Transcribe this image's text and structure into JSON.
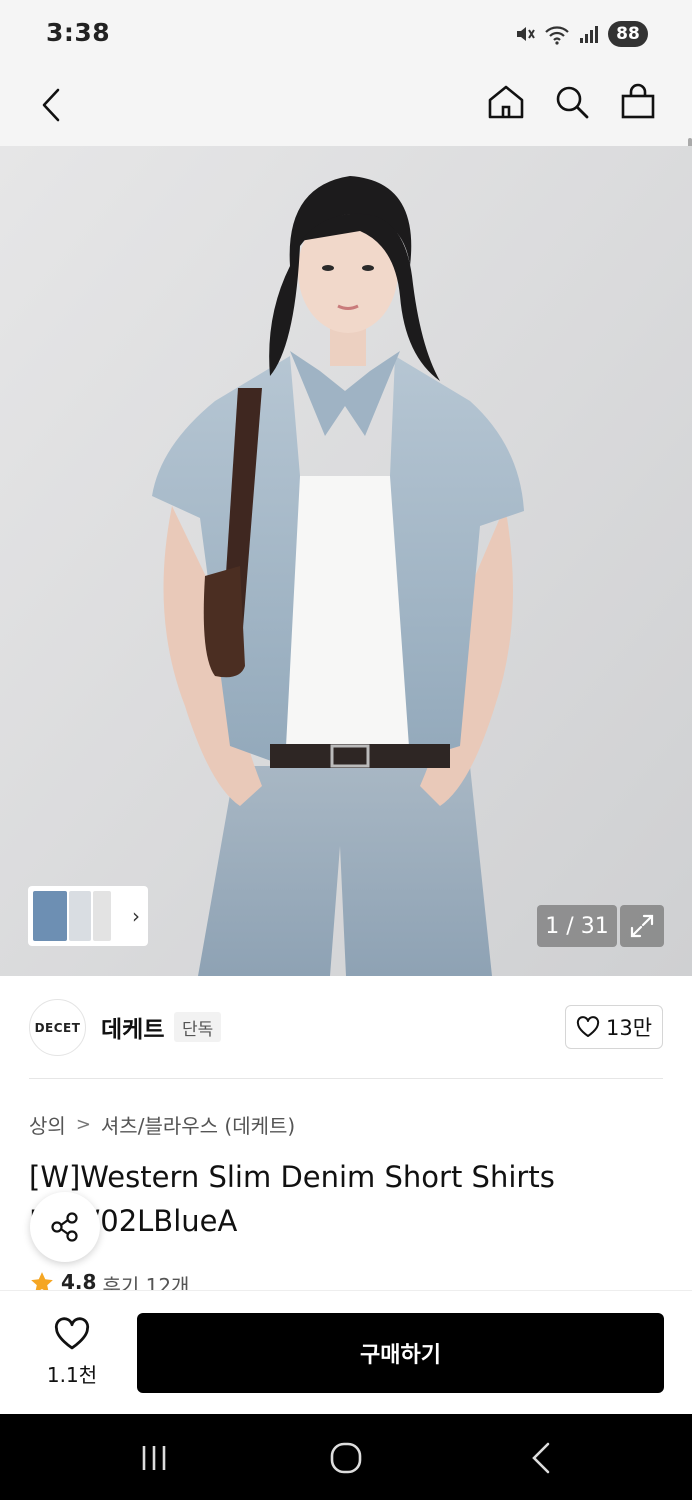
{
  "status_bar": {
    "time": "3:38",
    "battery": "88",
    "icons": [
      "mute-icon",
      "wifi-icon",
      "signal-icon",
      "battery-icon"
    ]
  },
  "app_bar": {
    "icons": [
      "back-arrow-icon",
      "home-icon",
      "search-icon",
      "shopping-bag-icon"
    ]
  },
  "gallery": {
    "page_counter": "1 / 31",
    "thumb_arrow": "›",
    "colors": {
      "background": "#dcdcdd",
      "denim": "#a9bccb",
      "hair": "#1c1b1c",
      "bag": "#4b2e22"
    }
  },
  "brand": {
    "logo_text": "DECET",
    "name": "데케트",
    "badge": "단독",
    "likes": "13만"
  },
  "product": {
    "breadcrumb": [
      "상의",
      "셔츠/블라우스 (데케트)"
    ],
    "breadcrumb_sep": ">",
    "title": "[W]Western Slim Denim Short Shirts DCW02LBlueA",
    "rating": "4.8",
    "review_text": "후기 12개"
  },
  "purchase_bar": {
    "wish_count": "1.1천",
    "buy_label": "구매하기",
    "colors": {
      "button": "#000000",
      "button_text": "#ffffff"
    }
  },
  "nav_bar": {
    "icons": [
      "recent-apps-icon",
      "home-circle-icon",
      "nav-back-icon"
    ]
  }
}
